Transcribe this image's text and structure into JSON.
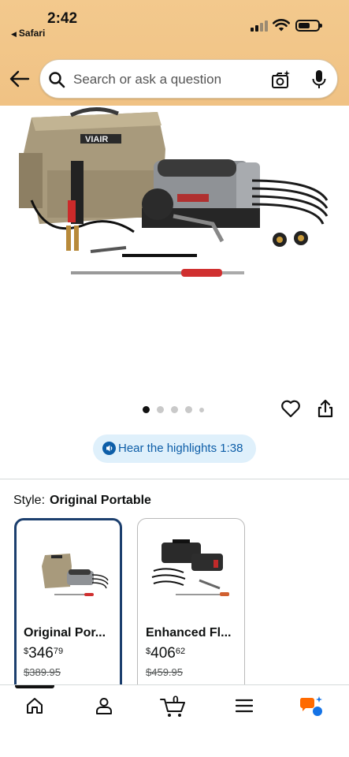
{
  "status_bar": {
    "time": "2:42",
    "back_app": "Safari"
  },
  "search": {
    "placeholder": "Search or ask a question"
  },
  "product": {
    "image_brand_text": "VIAIR",
    "image_count": 5,
    "active_image_index": 0,
    "highlights_label": "Hear the highlights 1:38"
  },
  "style": {
    "label": "Style:",
    "selected_value": "Original Portable",
    "options": [
      {
        "name": "Original Por...",
        "price_currency": "$",
        "price_whole": "346",
        "price_fraction": "79",
        "list_price": "$389.95",
        "selected": true
      },
      {
        "name": "Enhanced Fl...",
        "price_currency": "$",
        "price_whole": "406",
        "price_fraction": "62",
        "list_price": "$459.95",
        "selected": false
      }
    ]
  },
  "bottom_nav": {
    "items": [
      "home-icon",
      "account-icon",
      "cart-icon",
      "menu-icon",
      "rufus-icon"
    ],
    "cart_count": "0",
    "active": "home-icon"
  },
  "colors": {
    "header_bg": "#f0c284",
    "selected_border": "#1c3f6e",
    "highlights_bg": "#dff0fb",
    "highlights_text": "#0d5ea8",
    "accent_orange": "#ff6a00",
    "accent_blue": "#1473e6"
  }
}
